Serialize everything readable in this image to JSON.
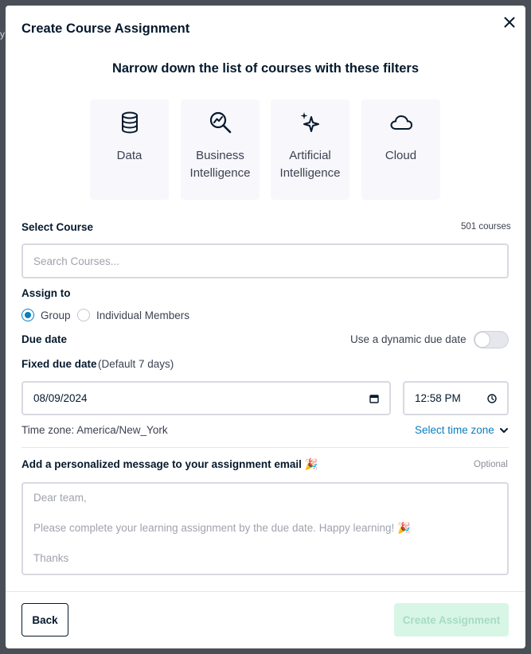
{
  "modal": {
    "title": "Create Course Assignment",
    "close_icon": "close-icon"
  },
  "filters": {
    "heading": "Narrow down the list of courses with these filters",
    "items": [
      {
        "label": "Data",
        "icon": "database-icon"
      },
      {
        "label": "Business Intelligence",
        "icon": "magnifier-chart-icon"
      },
      {
        "label": "Artificial Intelligence",
        "icon": "sparkles-icon"
      },
      {
        "label": "Cloud",
        "icon": "cloud-icon"
      }
    ]
  },
  "course": {
    "label": "Select Course",
    "count": "501 courses",
    "placeholder": "Search Courses..."
  },
  "assign": {
    "label": "Assign to",
    "options": [
      {
        "label": "Group",
        "selected": true
      },
      {
        "label": "Individual Members",
        "selected": false
      }
    ]
  },
  "due": {
    "label": "Due date",
    "dynamic_label": "Use a dynamic due date",
    "dynamic_enabled": false,
    "fixed_label": "Fixed due date",
    "fixed_hint": "(Default 7 days)",
    "date_value": "08/09/2024",
    "time_value": "12:58 PM",
    "timezone_text": "Time zone: America/New_York",
    "timezone_link": "Select time zone"
  },
  "message": {
    "label": "Add a personalized message to your assignment email 🎉",
    "optional": "Optional",
    "lines": [
      "Dear team,",
      "Please complete your learning assignment by the due date. Happy learning! 🎉",
      "Thanks"
    ]
  },
  "footer": {
    "back_label": "Back",
    "create_label": "Create Assignment"
  },
  "colors": {
    "accent": "#0c7dbe",
    "text": "#05192d",
    "create_disabled_bg": "#d8f6e6"
  }
}
